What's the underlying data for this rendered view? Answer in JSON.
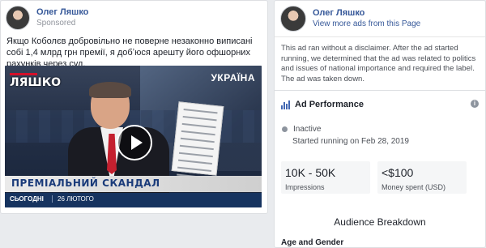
{
  "post": {
    "page_name": "Олег Ляшко",
    "sponsored": "Sponsored",
    "text": "Якщо Коболєв добровільно не поверне незаконно виписані собі 1,4 млрд грн премії, я добʼюся арешту його офшорних рахунків через суд.",
    "video": {
      "logo_left": "ЛЯШКО",
      "logo_right": "УКРАЇНА",
      "headline": "ПРЕМІАЛЬНИЙ СКАНДАЛ",
      "ticker_left": "СЬОГОДНІ",
      "ticker_right": "26 ЛЮТОГО"
    }
  },
  "ad_info": {
    "page_name": "Олег Ляшко",
    "more_ads_link": "View more ads from this Page",
    "disclaimer": "This ad ran without a disclaimer. After the ad started running, we determined that the ad was related to politics and issues of national importance and required the label. The ad was taken down.",
    "performance": {
      "title": "Ad Performance",
      "status": "Inactive",
      "started": "Started running on Feb 28, 2019",
      "metrics": [
        {
          "value": "10K - 50K",
          "label": "Impressions"
        },
        {
          "value": "<$100",
          "label": "Money spent (USD)"
        }
      ]
    },
    "audience_breakdown": "Audience Breakdown",
    "age_gender": "Age and Gender"
  }
}
